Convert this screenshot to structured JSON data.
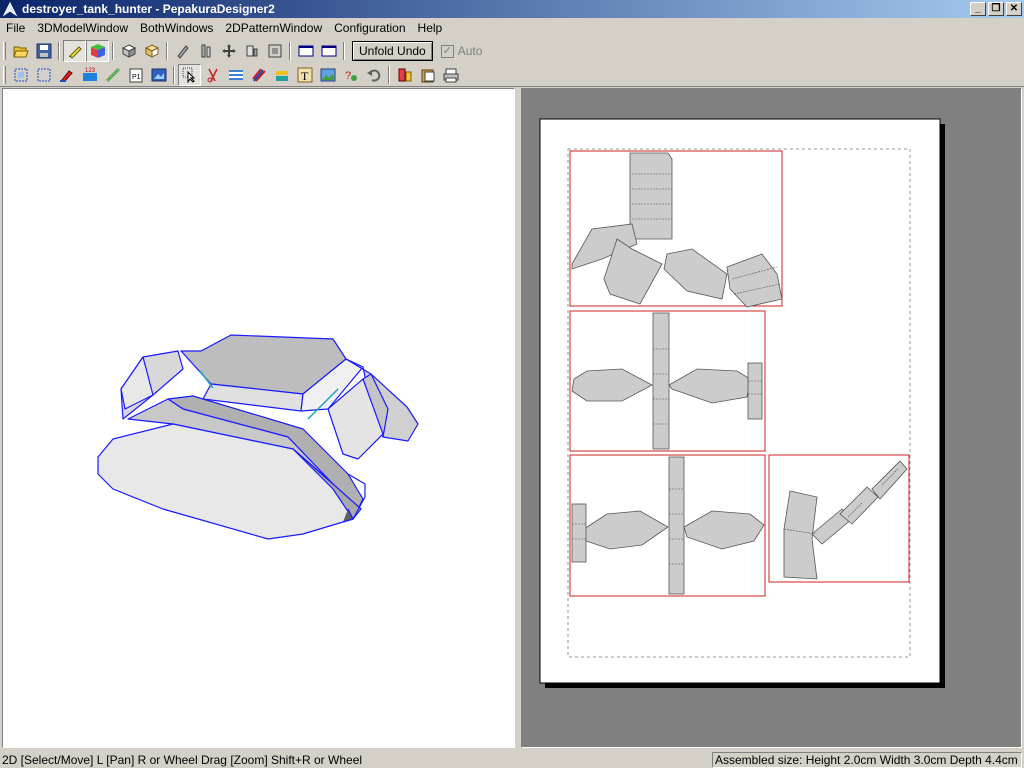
{
  "window": {
    "title": "destroyer_tank_hunter - PepakuraDesigner2",
    "min_glyph": "_",
    "restore_glyph": "❐",
    "close_glyph": "✕"
  },
  "menu": [
    "File",
    "3DModelWindow",
    "BothWindows",
    "2DPatternWindow",
    "Configuration",
    "Help"
  ],
  "toolbar1": {
    "icons": [
      "open-icon",
      "save-icon",
      "pencil-icon",
      "color-cube-icon",
      "box-view-icon",
      "box-flat-icon",
      "pen-icon",
      "column-icon",
      "move-icon",
      "rotate-icon",
      "fit-icon",
      "window-left-icon",
      "window-right-icon"
    ],
    "unfold_undo_label": "Unfold Undo",
    "auto_label": "Auto",
    "auto_checked": true
  },
  "toolbar2": {
    "icons": [
      "select-rect-icon",
      "select-icon",
      "paint-icon",
      "number-123-icon",
      "ruler-icon",
      "page-p1-icon",
      "image-icon",
      "cursor-select-icon",
      "cut-icon",
      "filmstrip-icon",
      "lines-icon",
      "layers-icon",
      "text-icon",
      "picture-icon",
      "question-edit-icon",
      "undo-arrow-icon",
      "print-icon",
      "paste-icon",
      "print-setup-icon"
    ]
  },
  "statusbar": {
    "left": "2D [Select/Move] L [Pan] R or Wheel Drag [Zoom] Shift+R or Wheel",
    "right": "Assembled size: Height 2.0cm Width 3.0cm Depth 4.4cm"
  },
  "colors": {
    "title_gradient_start": "#0a246a",
    "title_gradient_end": "#a6caf0",
    "model_edge": "#1a1aff",
    "part_fill": "#cccccc",
    "part_outline_red": "#cc2222"
  }
}
